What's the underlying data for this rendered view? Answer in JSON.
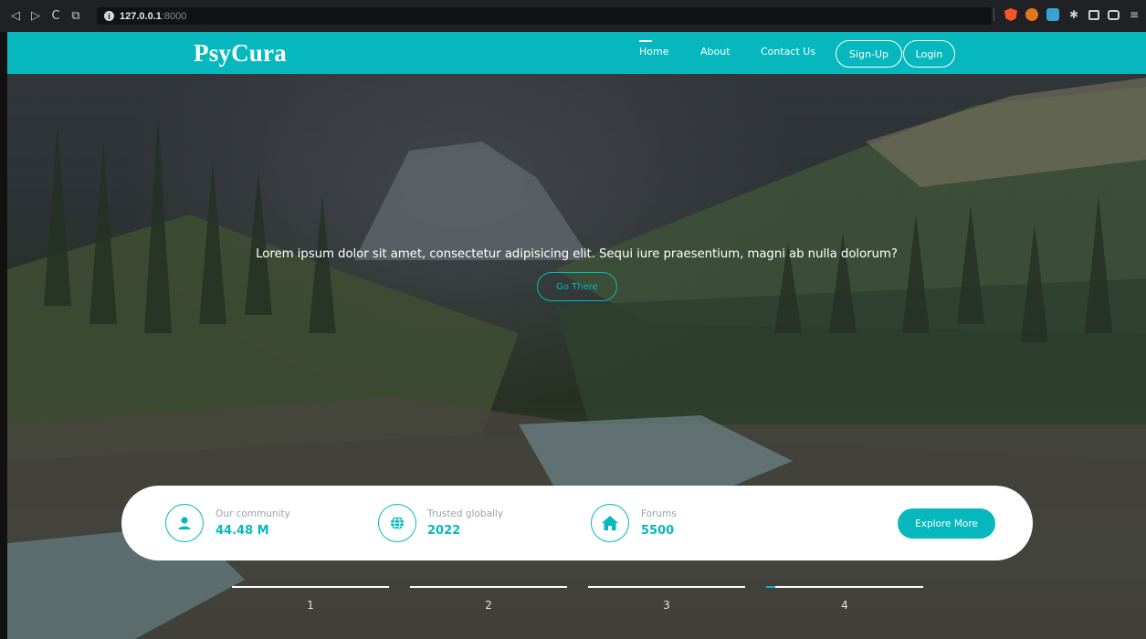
{
  "browser": {
    "nav_icons": [
      "◁",
      "▷",
      "C",
      "⧉"
    ],
    "url_host": "127.0.0.1",
    "url_port": ":8000"
  },
  "navbar": {
    "brand": "PsyCura",
    "links": {
      "home": "Home",
      "about": "About",
      "contact": "Contact Us"
    },
    "signup": "Sign-Up",
    "login": "Login"
  },
  "hero": {
    "tagline": "Lorem ipsum dolor sit amet, consectetur adipisicing elit. Sequi iure praesentium, magni ab nulla dolorum?",
    "cta": "Go There"
  },
  "stats": [
    {
      "label": "Our community",
      "value": "44.48 M",
      "icon": "user-icon"
    },
    {
      "label": "Trusted globally",
      "value": "2022",
      "icon": "globe-icon"
    },
    {
      "label": "Forums",
      "value": "5500",
      "icon": "home-icon"
    }
  ],
  "explore": "Explore More",
  "slides": {
    "s1": "1",
    "s2": "2",
    "s3": "3",
    "s4": "4",
    "active": 4
  },
  "colors": {
    "accent": "#06b8bd",
    "navbar": "#06b8bd",
    "card": "#ffffff"
  }
}
